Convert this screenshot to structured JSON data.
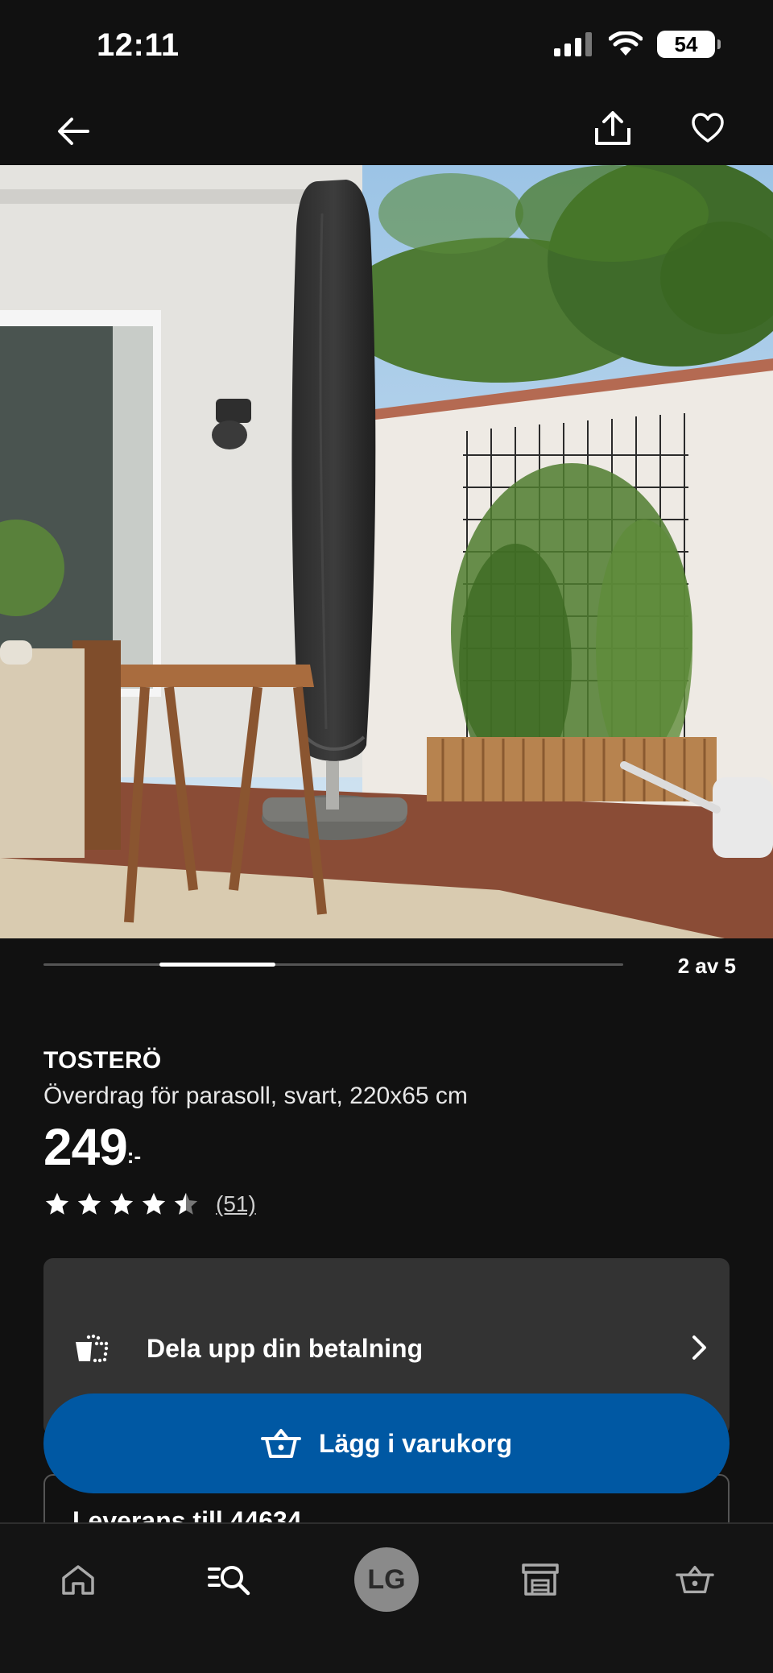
{
  "status_bar": {
    "time": "12:11",
    "battery": "54"
  },
  "product": {
    "name": "TOSTERÖ",
    "description": "Överdrag för parasoll, svart, 220x65 cm",
    "price_main": "249",
    "price_suffix": ":-",
    "rating": 4.5,
    "review_count": "(51)"
  },
  "carousel": {
    "counter": "2 av 5",
    "current": 2,
    "total": 5
  },
  "payment": {
    "label": "Dela upp din betalning"
  },
  "cart_button": {
    "label": "Lägg i varukorg"
  },
  "delivery": {
    "title": "Leverans till 44634"
  },
  "tab_bar": {
    "avatar_initials": "LG"
  },
  "colors": {
    "background": "#111111",
    "primary_button": "#0058a3",
    "card": "#333333"
  }
}
